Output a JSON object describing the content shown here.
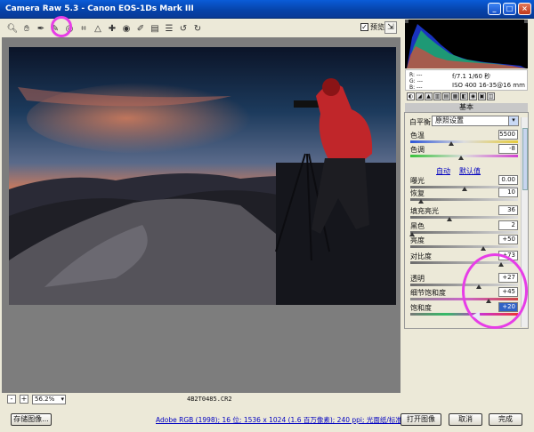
{
  "window": {
    "title": "Camera Raw 5.3  -  Canon EOS-1Ds Mark III"
  },
  "toolbar": {
    "tools": [
      "zoom-icon",
      "hand-icon",
      "white-balance-icon",
      "color-sampler-icon",
      "target-adjust-icon",
      "crop-icon",
      "straighten-icon",
      "spot-removal-icon",
      "red-eye-icon",
      "adjustment-brush-icon",
      "graduated-filter-icon",
      "preferences-icon",
      "rotate-left-icon",
      "rotate-right-icon"
    ],
    "preview_label": "预览",
    "preview_checked": "✓"
  },
  "status": {
    "zoom": "56.2%",
    "filename": "4B2T0485.CR2"
  },
  "camera_info": {
    "rgb": [
      "R: ---",
      "G: ---",
      "B: ---"
    ],
    "exif_line1": "f/7.1  1/60 秒",
    "exif_line2": "ISO 400   16-35@16 mm"
  },
  "panel": {
    "section_title": "基本",
    "wb_label": "白平衡:",
    "wb_value": "原照设置",
    "auto_link": "自动",
    "default_link": "默认值",
    "sliders": [
      {
        "label": "色温",
        "value": "5500",
        "pos": 0.38,
        "track": "temp"
      },
      {
        "label": "色调",
        "value": "-8",
        "pos": 0.47,
        "track": "tint"
      },
      {
        "label": "曝光",
        "value": "0.00",
        "pos": 0.5,
        "track": "gray"
      },
      {
        "label": "恢复",
        "value": "10",
        "pos": 0.1,
        "track": "gray"
      },
      {
        "label": "填充亮光",
        "value": "36",
        "pos": 0.36,
        "track": "gray"
      },
      {
        "label": "黑色",
        "value": "2",
        "pos": 0.02,
        "track": "gray"
      },
      {
        "label": "亮度",
        "value": "+50",
        "pos": 0.68,
        "track": "gray"
      },
      {
        "label": "对比度",
        "value": "+73",
        "pos": 0.84,
        "track": "gray"
      },
      {
        "label": "透明",
        "value": "+27",
        "pos": 0.64,
        "track": "gray"
      },
      {
        "label": "细节饱和度",
        "value": "+45",
        "pos": 0.73,
        "track": "vibr"
      },
      {
        "label": "饱和度",
        "value": "+20",
        "pos": 0.6,
        "track": "sat"
      }
    ]
  },
  "bottom": {
    "save_label": "存储图像...",
    "info": "Adobe RGB (1998); 16 位; 1536 x 1024 (1.6 百万像素); 240 ppi; 光面纸/标准",
    "open_label": "打开图像",
    "cancel_label": "取消",
    "done_label": "完成"
  },
  "colors": {
    "highlight": "#e73de7",
    "title_bar": "#0642a8"
  }
}
